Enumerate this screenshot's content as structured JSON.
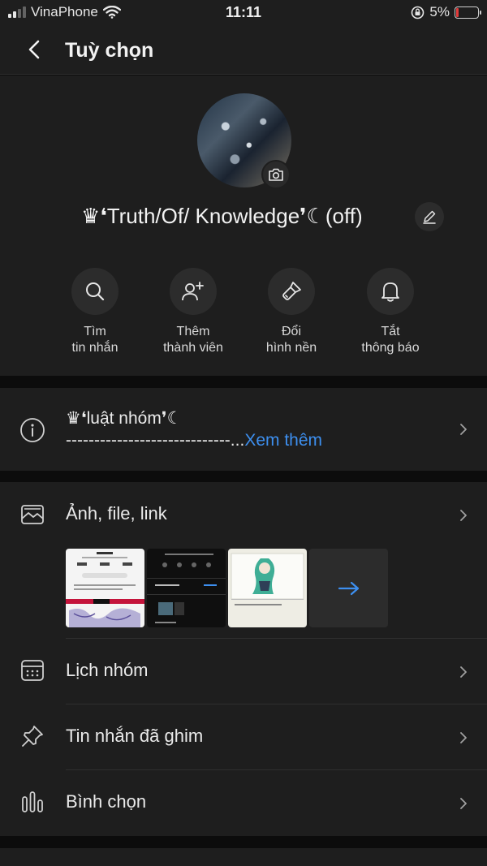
{
  "status_bar": {
    "carrier": "VinaPhone",
    "time": "11:11",
    "battery_percent": "5%"
  },
  "nav": {
    "title": "Tuỳ chọn"
  },
  "profile": {
    "group_name": "♛❛Truth/Of/ Knowledge❜☾(off)"
  },
  "actions": [
    {
      "line1": "Tìm",
      "line2": "tin nhắn",
      "icon": "search-icon"
    },
    {
      "line1": "Thêm",
      "line2": "thành viên",
      "icon": "add-member-icon"
    },
    {
      "line1": "Đổi",
      "line2": "hình nền",
      "icon": "paintbrush-icon"
    },
    {
      "line1": "Tắt",
      "line2": "thông báo",
      "icon": "bell-icon"
    }
  ],
  "rules": {
    "title": "♛❛luật nhóm❜☾",
    "description": "-----------------------------...",
    "more": "Xem thêm"
  },
  "menu": {
    "media": "Ảnh, file, link",
    "calendar": "Lịch nhóm",
    "pinned": "Tin nhắn đã ghim",
    "polls": "Bình chọn"
  },
  "colors": {
    "background": "#0c0c0c",
    "panel": "#1e1e1e",
    "accent": "#3d8fef",
    "battery_low": "#e23b3b"
  }
}
